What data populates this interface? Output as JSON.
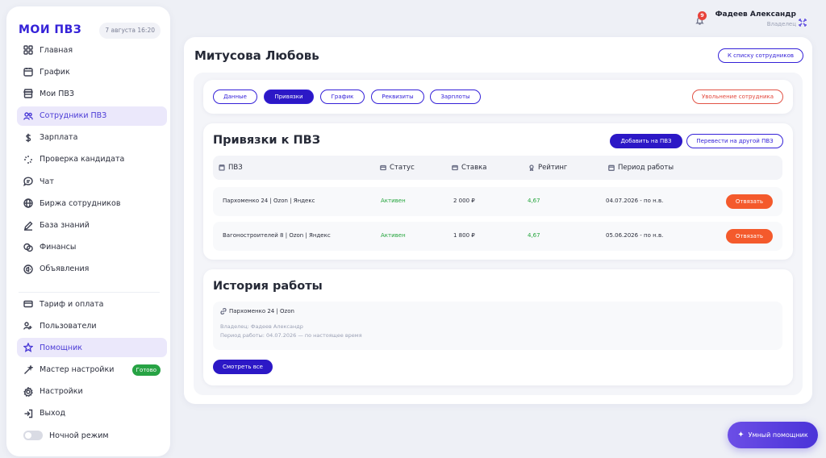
{
  "sidebar": {
    "logo": "МОИ ПВЗ",
    "date": "7 августа 16:20",
    "items": [
      {
        "label": "Главная",
        "icon": "grid-icon"
      },
      {
        "label": "График",
        "icon": "calendar-icon"
      },
      {
        "label": "Мои ПВЗ",
        "icon": "store-icon"
      },
      {
        "label": "Сотрудники ПВЗ",
        "icon": "users-icon",
        "active": true
      },
      {
        "label": "Зарплата",
        "icon": "dollar-icon"
      },
      {
        "label": "Проверка кандидата",
        "icon": "loader-icon"
      },
      {
        "label": "Чат",
        "icon": "chat-icon"
      },
      {
        "label": "Биржа сотрудников",
        "icon": "globe-icon"
      },
      {
        "label": "База знаний",
        "icon": "pen-icon"
      },
      {
        "label": "Финансы",
        "icon": "coins-icon"
      },
      {
        "label": "Объявления",
        "icon": "megaphone-icon"
      }
    ],
    "items2": [
      {
        "label": "Тариф и оплата",
        "icon": "card-icon"
      },
      {
        "label": "Пользователи",
        "icon": "user-group-icon"
      },
      {
        "label": "Помощник",
        "icon": "star-icon",
        "active": true
      },
      {
        "label": "Мастер настройки",
        "icon": "wand-icon",
        "badge": "Готово"
      },
      {
        "label": "Настройки",
        "icon": "gear-icon"
      },
      {
        "label": "Выход",
        "icon": "logout-icon"
      },
      {
        "label": "Ночной режим",
        "icon": "toggle"
      }
    ]
  },
  "user": {
    "notifications": "9",
    "name": "Фадеев Александр",
    "role": "Владелец"
  },
  "page": {
    "title": "Митусова Любовь",
    "back_button": "К списку сотрудников"
  },
  "tabs": {
    "items": [
      "Данные",
      "Привязки",
      "График",
      "Реквизиты",
      "Зарплоты"
    ],
    "active_index": 1,
    "dismiss_button": "Увольнение сотрудника"
  },
  "bindings": {
    "title": "Привязки к ПВЗ",
    "add_button": "Добавить на ПВЗ",
    "transfer_button": "Перевести на другой ПВЗ",
    "columns": [
      "ПВЗ",
      "Статус",
      "Ставка",
      "Рейтинг",
      "Период работы"
    ],
    "rows": [
      {
        "pvz": "Пархоменко 24 | Ozon | Яндекс",
        "status": "Активен",
        "rate": "2 000 ₽",
        "rating": "4,67",
        "period": "04.07.2026 - по н.в.",
        "action": "Отвязать"
      },
      {
        "pvz": "Вагоностроителей 8 | Ozon | Яндекс",
        "status": "Активен",
        "rate": "1 800 ₽",
        "rating": "4,67",
        "period": "05.06.2026 - по н.в.",
        "action": "Отвязать"
      }
    ]
  },
  "history": {
    "title": "История работы",
    "item_title": "Пархоменко 24 | Ozon",
    "owner_line": "Владелец: Фадеев Александр",
    "period_line": "Период работы: 04.07.2026 — по настоящее время",
    "view_all_button": "Смотреть все"
  },
  "assistant_button": "Умный помощник",
  "colors": {
    "brand": "#3421d8",
    "accent_orange": "#f45a2c",
    "status_green": "#25a53d",
    "danger": "#e2463b"
  }
}
